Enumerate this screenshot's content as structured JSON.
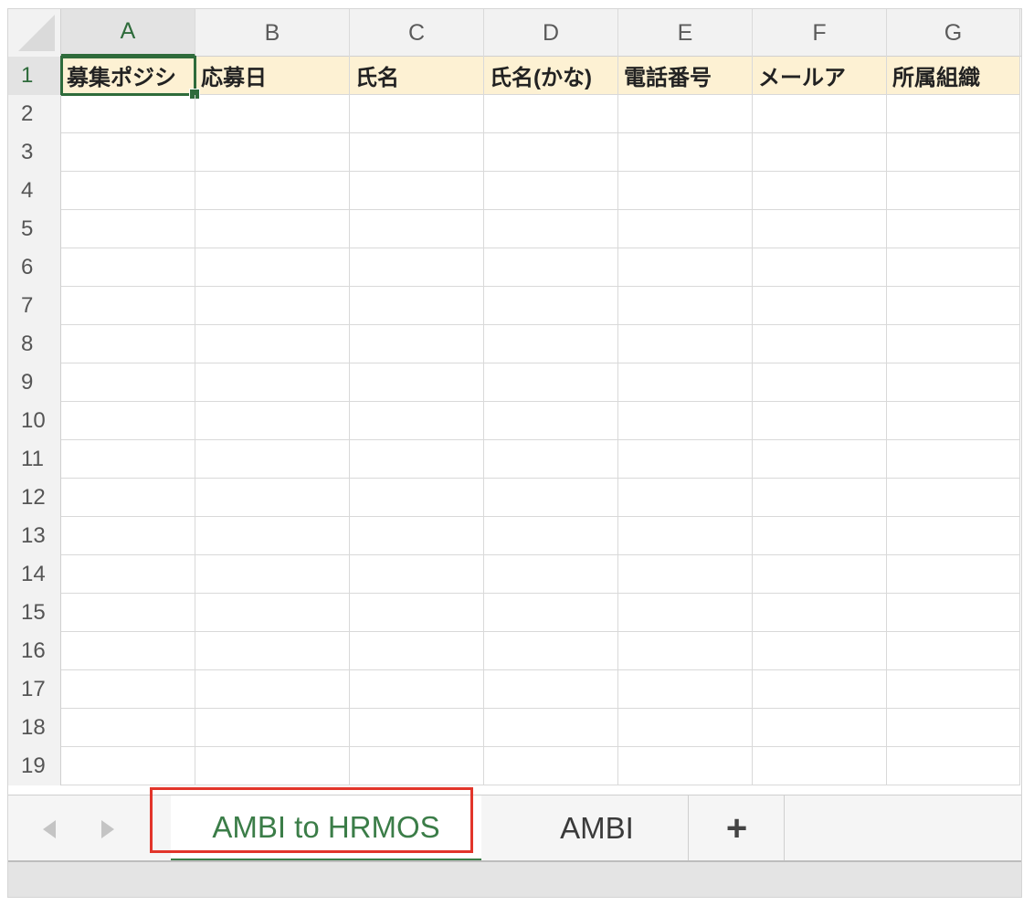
{
  "columns": [
    "A",
    "B",
    "C",
    "D",
    "E",
    "F",
    "G"
  ],
  "rows": [
    "1",
    "2",
    "3",
    "4",
    "5",
    "6",
    "7",
    "8",
    "9",
    "10",
    "11",
    "12",
    "13",
    "14",
    "15",
    "16",
    "17",
    "18",
    "19"
  ],
  "row1_cells": [
    "募集ポジシ",
    "応募日",
    "氏名",
    "氏名(かな)",
    "電話番号",
    "メールア",
    "所属組織"
  ],
  "selected_cell": "A1",
  "sheet_tabs": {
    "active": "AMBI to HRMOS",
    "second": "AMBI",
    "add": "+"
  },
  "colors": {
    "accent": "#2e6b3b",
    "header_row_fill": "#fdf1d3",
    "highlight": "#e2352b"
  }
}
